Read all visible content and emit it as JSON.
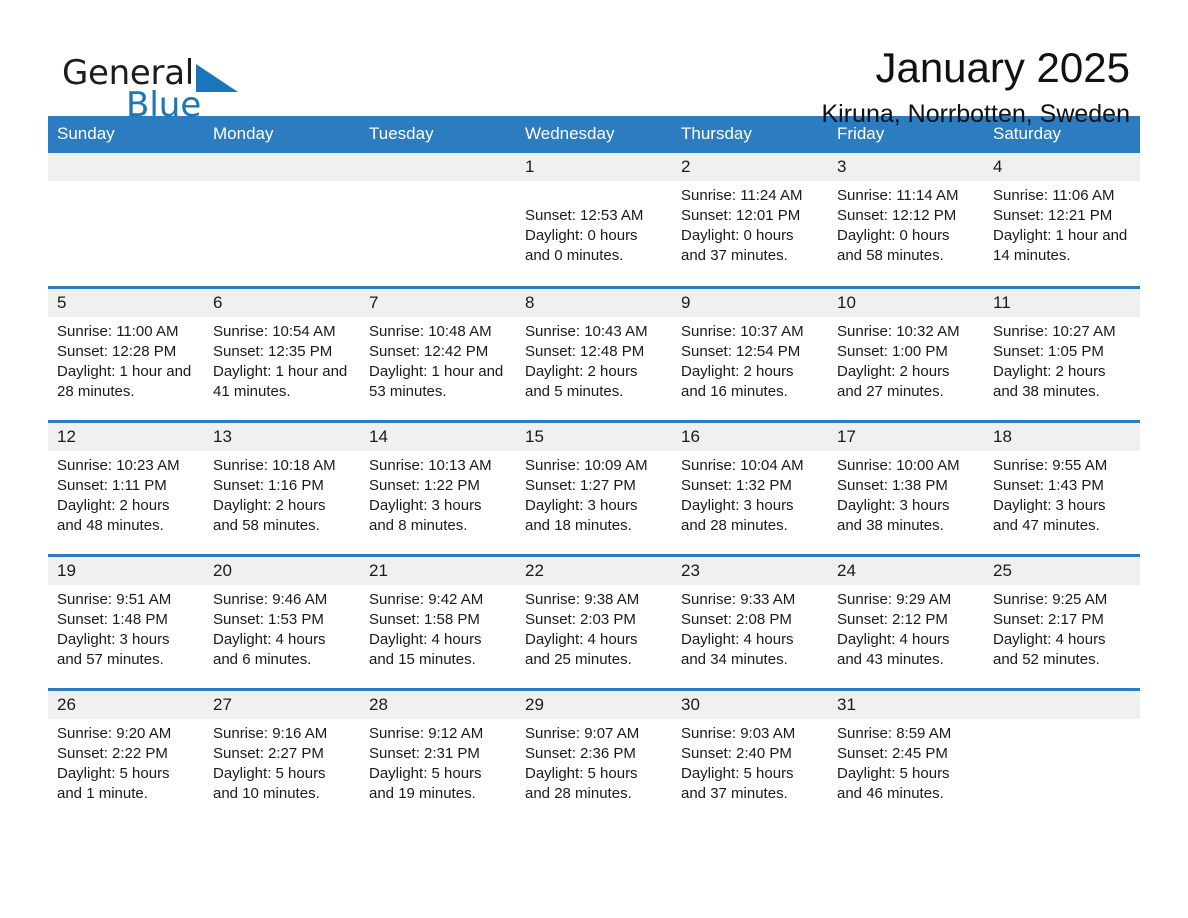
{
  "logo": {
    "word_one": "General",
    "word_two": "Blue",
    "triangle": "blue-triangle-icon"
  },
  "header": {
    "month_title": "January 2025",
    "location": "Kiruna, Norrbotten, Sweden"
  },
  "colors": {
    "header_blue": "#2b7cc0",
    "logo_blue": "#1b75bb",
    "daynum_band": "#f0f0f0",
    "text": "#1a1a1a"
  },
  "weekday_headers": [
    "Sunday",
    "Monday",
    "Tuesday",
    "Wednesday",
    "Thursday",
    "Friday",
    "Saturday"
  ],
  "weeks": [
    [
      {
        "day": "",
        "lines": []
      },
      {
        "day": "",
        "lines": []
      },
      {
        "day": "",
        "lines": []
      },
      {
        "day": "1",
        "lines": [
          "",
          "Sunset: 12:53 AM",
          "Daylight: 0 hours",
          "and 0 minutes."
        ]
      },
      {
        "day": "2",
        "lines": [
          "Sunrise: 11:24 AM",
          "Sunset: 12:01 PM",
          "Daylight: 0 hours",
          "and 37 minutes."
        ]
      },
      {
        "day": "3",
        "lines": [
          "Sunrise: 11:14 AM",
          "Sunset: 12:12 PM",
          "Daylight: 0 hours",
          "and 58 minutes."
        ]
      },
      {
        "day": "4",
        "lines": [
          "Sunrise: 11:06 AM",
          "Sunset: 12:21 PM",
          "Daylight: 1 hour and",
          "14 minutes."
        ]
      }
    ],
    [
      {
        "day": "5",
        "lines": [
          "Sunrise: 11:00 AM",
          "Sunset: 12:28 PM",
          "Daylight: 1 hour and",
          "28 minutes."
        ]
      },
      {
        "day": "6",
        "lines": [
          "Sunrise: 10:54 AM",
          "Sunset: 12:35 PM",
          "Daylight: 1 hour and",
          "41 minutes."
        ]
      },
      {
        "day": "7",
        "lines": [
          "Sunrise: 10:48 AM",
          "Sunset: 12:42 PM",
          "Daylight: 1 hour and",
          "53 minutes."
        ]
      },
      {
        "day": "8",
        "lines": [
          "Sunrise: 10:43 AM",
          "Sunset: 12:48 PM",
          "Daylight: 2 hours",
          "and 5 minutes."
        ]
      },
      {
        "day": "9",
        "lines": [
          "Sunrise: 10:37 AM",
          "Sunset: 12:54 PM",
          "Daylight: 2 hours",
          "and 16 minutes."
        ]
      },
      {
        "day": "10",
        "lines": [
          "Sunrise: 10:32 AM",
          "Sunset: 1:00 PM",
          "Daylight: 2 hours",
          "and 27 minutes."
        ]
      },
      {
        "day": "11",
        "lines": [
          "Sunrise: 10:27 AM",
          "Sunset: 1:05 PM",
          "Daylight: 2 hours",
          "and 38 minutes."
        ]
      }
    ],
    [
      {
        "day": "12",
        "lines": [
          "Sunrise: 10:23 AM",
          "Sunset: 1:11 PM",
          "Daylight: 2 hours",
          "and 48 minutes."
        ]
      },
      {
        "day": "13",
        "lines": [
          "Sunrise: 10:18 AM",
          "Sunset: 1:16 PM",
          "Daylight: 2 hours",
          "and 58 minutes."
        ]
      },
      {
        "day": "14",
        "lines": [
          "Sunrise: 10:13 AM",
          "Sunset: 1:22 PM",
          "Daylight: 3 hours",
          "and 8 minutes."
        ]
      },
      {
        "day": "15",
        "lines": [
          "Sunrise: 10:09 AM",
          "Sunset: 1:27 PM",
          "Daylight: 3 hours",
          "and 18 minutes."
        ]
      },
      {
        "day": "16",
        "lines": [
          "Sunrise: 10:04 AM",
          "Sunset: 1:32 PM",
          "Daylight: 3 hours",
          "and 28 minutes."
        ]
      },
      {
        "day": "17",
        "lines": [
          "Sunrise: 10:00 AM",
          "Sunset: 1:38 PM",
          "Daylight: 3 hours",
          "and 38 minutes."
        ]
      },
      {
        "day": "18",
        "lines": [
          "Sunrise: 9:55 AM",
          "Sunset: 1:43 PM",
          "Daylight: 3 hours",
          "and 47 minutes."
        ]
      }
    ],
    [
      {
        "day": "19",
        "lines": [
          "Sunrise: 9:51 AM",
          "Sunset: 1:48 PM",
          "Daylight: 3 hours",
          "and 57 minutes."
        ]
      },
      {
        "day": "20",
        "lines": [
          "Sunrise: 9:46 AM",
          "Sunset: 1:53 PM",
          "Daylight: 4 hours",
          "and 6 minutes."
        ]
      },
      {
        "day": "21",
        "lines": [
          "Sunrise: 9:42 AM",
          "Sunset: 1:58 PM",
          "Daylight: 4 hours",
          "and 15 minutes."
        ]
      },
      {
        "day": "22",
        "lines": [
          "Sunrise: 9:38 AM",
          "Sunset: 2:03 PM",
          "Daylight: 4 hours",
          "and 25 minutes."
        ]
      },
      {
        "day": "23",
        "lines": [
          "Sunrise: 9:33 AM",
          "Sunset: 2:08 PM",
          "Daylight: 4 hours",
          "and 34 minutes."
        ]
      },
      {
        "day": "24",
        "lines": [
          "Sunrise: 9:29 AM",
          "Sunset: 2:12 PM",
          "Daylight: 4 hours",
          "and 43 minutes."
        ]
      },
      {
        "day": "25",
        "lines": [
          "Sunrise: 9:25 AM",
          "Sunset: 2:17 PM",
          "Daylight: 4 hours",
          "and 52 minutes."
        ]
      }
    ],
    [
      {
        "day": "26",
        "lines": [
          "Sunrise: 9:20 AM",
          "Sunset: 2:22 PM",
          "Daylight: 5 hours",
          "and 1 minute."
        ]
      },
      {
        "day": "27",
        "lines": [
          "Sunrise: 9:16 AM",
          "Sunset: 2:27 PM",
          "Daylight: 5 hours",
          "and 10 minutes."
        ]
      },
      {
        "day": "28",
        "lines": [
          "Sunrise: 9:12 AM",
          "Sunset: 2:31 PM",
          "Daylight: 5 hours",
          "and 19 minutes."
        ]
      },
      {
        "day": "29",
        "lines": [
          "Sunrise: 9:07 AM",
          "Sunset: 2:36 PM",
          "Daylight: 5 hours",
          "and 28 minutes."
        ]
      },
      {
        "day": "30",
        "lines": [
          "Sunrise: 9:03 AM",
          "Sunset: 2:40 PM",
          "Daylight: 5 hours",
          "and 37 minutes."
        ]
      },
      {
        "day": "31",
        "lines": [
          "Sunrise: 8:59 AM",
          "Sunset: 2:45 PM",
          "Daylight: 5 hours",
          "and 46 minutes."
        ]
      },
      {
        "day": "",
        "lines": []
      }
    ]
  ]
}
